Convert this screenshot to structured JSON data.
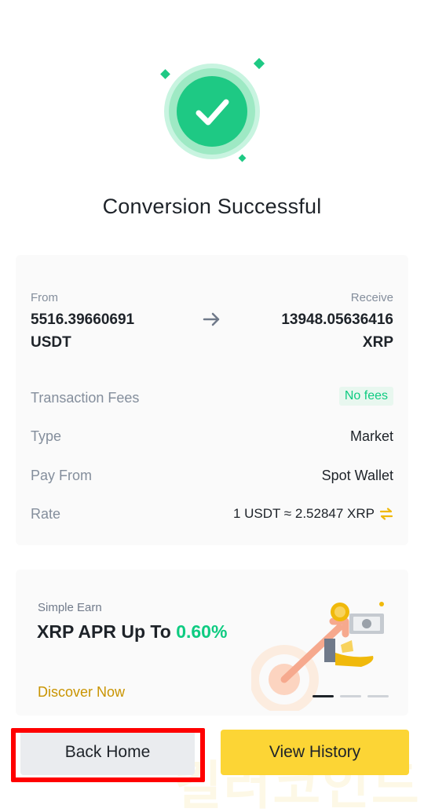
{
  "title": "Conversion Successful",
  "conversion": {
    "from_label": "From",
    "from_amount": "5516.39660691",
    "from_currency": "USDT",
    "to_label": "Receive",
    "to_amount": "13948.05636416",
    "to_currency": "XRP"
  },
  "details": {
    "fees_label": "Transaction Fees",
    "fees_value": "No fees",
    "type_label": "Type",
    "type_value": "Market",
    "pay_label": "Pay From",
    "pay_value": "Spot Wallet",
    "rate_label": "Rate",
    "rate_value": "1 USDT ≈ 2.52847 XRP"
  },
  "promo": {
    "eyebrow": "Simple Earn",
    "title_prefix": "XRP APR Up To ",
    "title_pct": "0.60%",
    "link": "Discover Now",
    "carousel_active_index": 0,
    "carousel_count": 3
  },
  "buttons": {
    "back_home": "Back Home",
    "view_history": "View History"
  },
  "watermark_text": "킬러코인드",
  "colors": {
    "success_green": "#0ecb81",
    "brand_yellow": "#fcd535",
    "link_gold": "#c99400",
    "highlight_red": "#ff0000"
  },
  "icons": [
    "check-icon",
    "arrow-right-icon",
    "swap-icon"
  ]
}
